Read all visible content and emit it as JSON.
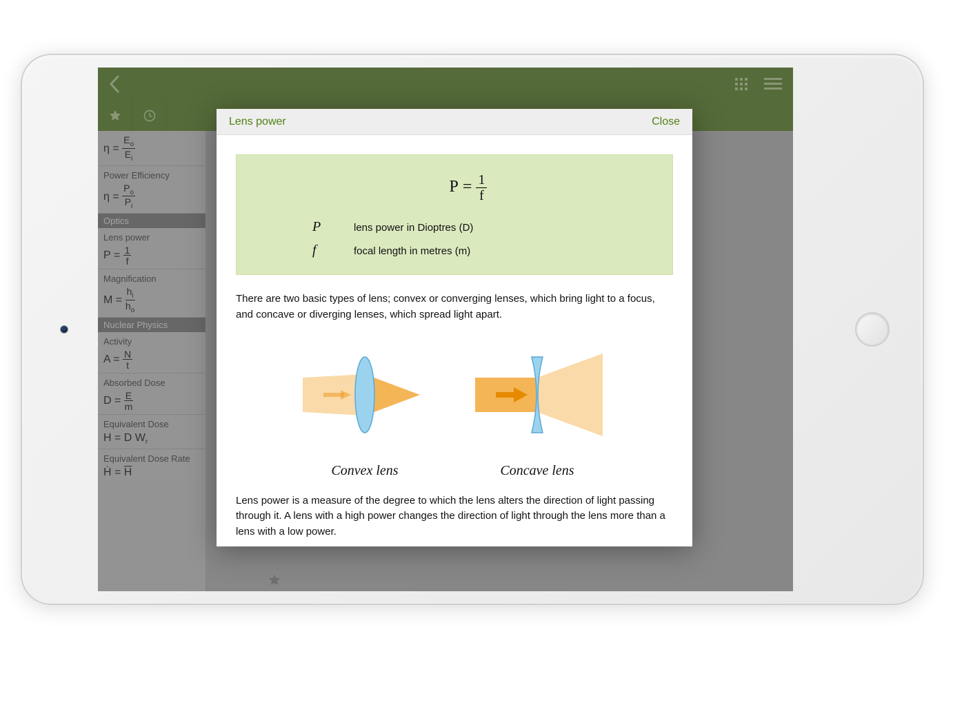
{
  "modal": {
    "title": "Lens power",
    "close": "Close",
    "formula_html": "P = 1 / f",
    "vars": [
      {
        "sym": "P",
        "def": "lens power in Dioptres (D)"
      },
      {
        "sym": "f",
        "def": "focal length in metres (m)"
      }
    ],
    "para1": "There are two basic types of lens; convex or converging lenses, which bring light to a focus, and concave or diverging lenses, which spread light apart.",
    "convex_label": "Convex lens",
    "concave_label": "Concave lens",
    "para2": "Lens power is a measure of the degree to which the lens alters the direction of light passing through it. A lens with a high power changes the direction of light through the lens more than a lens with a low power."
  },
  "sidebar": {
    "items": [
      {
        "title": "",
        "formula": "η = E_o / E_i"
      },
      {
        "title": "Power Efficiency",
        "formula": "η = P_o / P_i"
      }
    ],
    "section_optics": "Optics",
    "optics_items": [
      {
        "title": "Lens power",
        "formula": "P = 1 / f"
      },
      {
        "title": "Magnification",
        "formula": "M = h_i / h_o"
      }
    ],
    "section_nuclear": "Nuclear Physics",
    "nuclear_items": [
      {
        "title": "Activity",
        "formula": "A = N / t"
      },
      {
        "title": "Absorbed Dose",
        "formula": "D = E / m"
      },
      {
        "title": "Equivalent Dose",
        "formula": "H = D W_r"
      },
      {
        "title": "Equivalent Dose Rate",
        "formula": "H = H / "
      }
    ]
  }
}
